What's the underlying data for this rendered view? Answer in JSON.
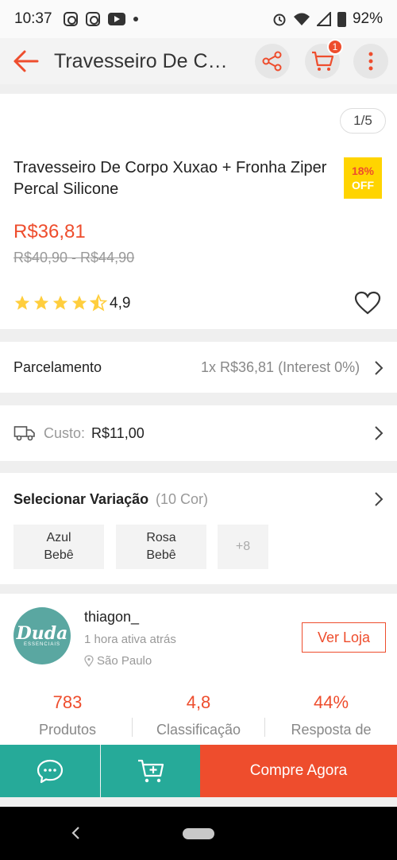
{
  "status_bar": {
    "time": "10:37",
    "battery": "92%"
  },
  "header": {
    "title": "Travesseiro De Corpo Xuxao + Fronha Ziper Percal Silicone",
    "cart_badge": "1"
  },
  "product": {
    "image_counter": "1/5",
    "title": "Travesseiro De Corpo Xuxao + Fronha Ziper Percal Silicone",
    "discount_pct": "18%",
    "discount_label": "OFF",
    "price": "R$36,81",
    "original_price": "R$40,90 - R$44,90",
    "rating": 4.5,
    "rating_text": "4,9"
  },
  "installment": {
    "label": "Parcelamento",
    "value": "1x R$36,81 (Interest 0%)"
  },
  "shipping": {
    "cost_label": "Custo:",
    "cost_value": "R$11,00"
  },
  "variation": {
    "label": "Selecionar Variação",
    "count": "(10 Cor)",
    "options": [
      {
        "line1": "Azul",
        "line2": "Bebê"
      },
      {
        "line1": "Rosa",
        "line2": "Bebê"
      }
    ],
    "more": "+8"
  },
  "shop": {
    "logo_text": "Duda",
    "logo_subtext": "ESSENCIAIS",
    "name": "thiagon_",
    "active": "1 hora ativa atrás",
    "location": "São Paulo",
    "visit_label": "Ver Loja",
    "stats": [
      {
        "value": "783",
        "label": "Produtos"
      },
      {
        "value": "4,8",
        "label": "Classificação"
      },
      {
        "value": "44%",
        "label": "Resposta de"
      }
    ]
  },
  "actions": {
    "buy_now": "Compre Agora"
  },
  "colors": {
    "accent": "#ee4d2d",
    "teal": "#26aa99",
    "badge_yellow": "#ffd400"
  }
}
